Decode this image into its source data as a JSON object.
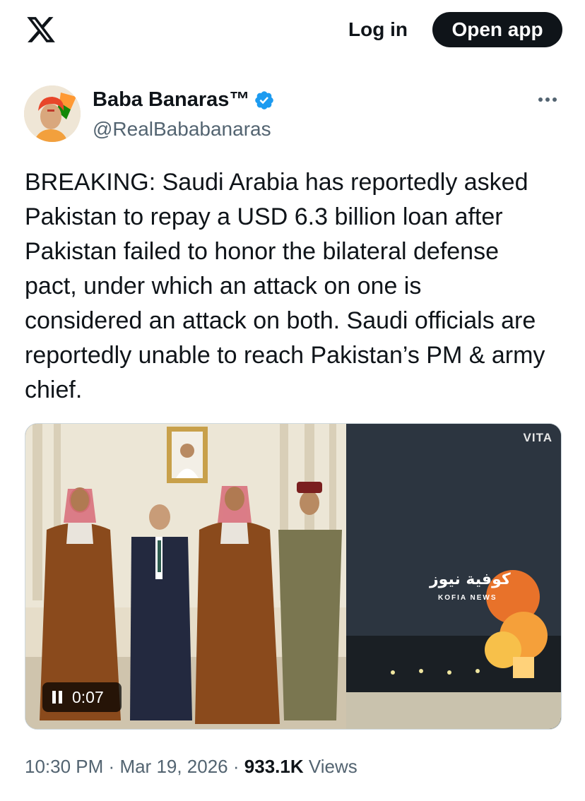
{
  "header": {
    "logo_icon": "x-logo-icon",
    "login_label": "Log in",
    "open_app_label": "Open app"
  },
  "author": {
    "name": "Baba Banaras™",
    "handle": "@RealBababanaras",
    "verified_color": "#1d9bf0"
  },
  "tweet": {
    "text": "BREAKING: Saudi Arabia has reportedly asked\nPakistan to repay a USD 6.3 billion loan after\nPakistan failed to honor the bilateral defense\npact, under which an attack on one is\nconsidered an attack on both. Saudi officials are\nreportedly unable to reach Pakistan’s PM & army\nchief."
  },
  "media": {
    "watermark": "VITA",
    "overlay_arabic": "كوفية نيوز",
    "overlay_english": "KOFIA NEWS",
    "video_time": "0:07"
  },
  "meta": {
    "time": "10:30 PM",
    "sep1": "·",
    "date": "Mar 19, 2026",
    "sep2": "·",
    "views_count": "933.1K",
    "views_label": "Views"
  }
}
